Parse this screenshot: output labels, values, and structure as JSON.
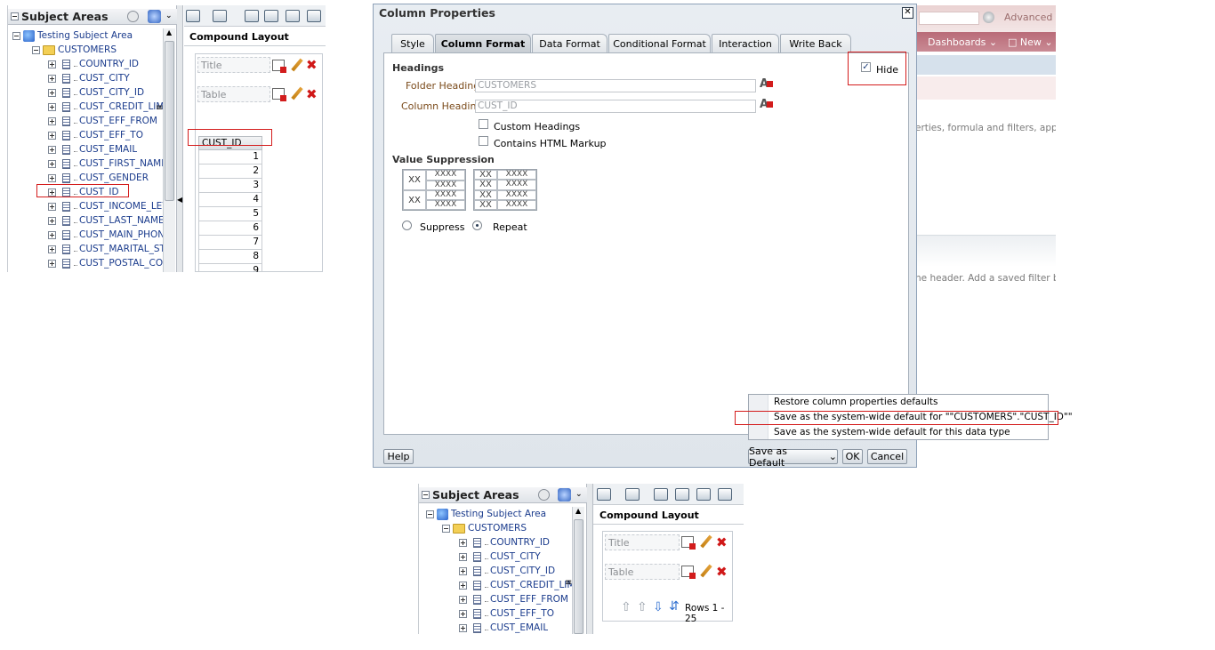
{
  "left_pane": {
    "title": "Subject Areas",
    "root": "Testing Subject Area",
    "folder": "CUSTOMERS",
    "columns": [
      "COUNTRY_ID",
      "CUST_CITY",
      "CUST_CITY_ID",
      "CUST_CREDIT_LIMI",
      "CUST_EFF_FROM",
      "CUST_EFF_TO",
      "CUST_EMAIL",
      "CUST_FIRST_NAME",
      "CUST_GENDER",
      "CUST_ID",
      "CUST_INCOME_LEV",
      "CUST_LAST_NAME",
      "CUST_MAIN_PHONI",
      "CUST_MARITAL_ST",
      "CUST_POSTAL_COI"
    ],
    "layout_title": "Compound Layout",
    "title_view": "Title",
    "table_view": "Table",
    "table_column": "CUST_ID",
    "rows": [
      "1",
      "2",
      "3",
      "4",
      "5",
      "6",
      "7",
      "8",
      "9"
    ]
  },
  "background_app": {
    "advanced_link": "Advanced",
    "dashboards_menu": "Dashboards",
    "new_menu": "New",
    "hint_text_1": "erties, formula and filters, apply",
    "hint_text_2": "ne header. Add a saved filter by"
  },
  "dialog": {
    "title": "Column Properties",
    "tabs": [
      "Style",
      "Column Format",
      "Data Format",
      "Conditional Format",
      "Interaction",
      "Write Back"
    ],
    "selected_tab": "Column Format",
    "headings_label": "Headings",
    "folder_heading_label": "Folder Heading",
    "folder_heading_value": "CUSTOMERS",
    "column_heading_label": "Column Heading",
    "column_heading_value": "CUST_ID",
    "custom_headings": "Custom Headings",
    "html_markup": "Contains HTML Markup",
    "hide_label": "Hide",
    "hide_checked": true,
    "value_suppression_label": "Value Suppression",
    "grid_xx": "XX",
    "grid_xxxx": "XXXX",
    "suppress_label": "Suppress",
    "repeat_label": "Repeat",
    "selected_suppression": "Repeat",
    "help_button": "Help",
    "save_default_button": "Save as Default",
    "ok_button": "OK",
    "cancel_button": "Cancel",
    "menu_items": [
      "Restore column properties defaults",
      "Save as the system-wide default for \"\"CUSTOMERS\".\"CUST_ID\"\"",
      "Save as the system-wide default for this data type"
    ]
  },
  "bottom_pane": {
    "title": "Subject Areas",
    "root": "Testing Subject Area",
    "folder": "CUSTOMERS",
    "columns": [
      "COUNTRY_ID",
      "CUST_CITY",
      "CUST_CITY_ID",
      "CUST_CREDIT_LIMI",
      "CUST_EFF_FROM",
      "CUST_EFF_TO",
      "CUST_EMAIL"
    ],
    "layout_title": "Compound Layout",
    "title_view": "Title",
    "table_view": "Table",
    "rows_label": "Rows 1 - 25"
  }
}
